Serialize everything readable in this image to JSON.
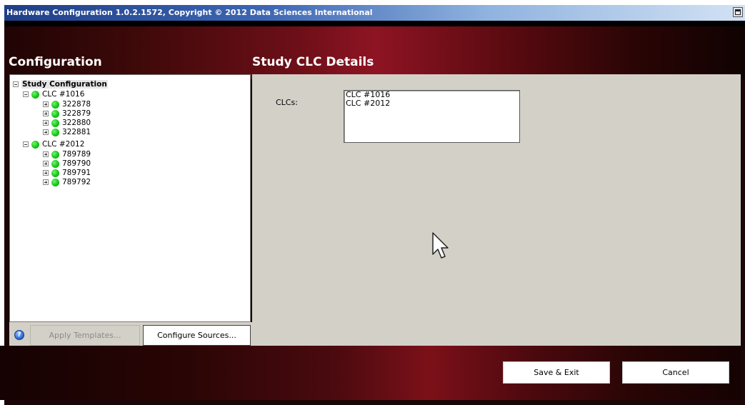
{
  "window": {
    "title": "Hardware Configuration 1.0.2.1572, Copyright © 2012 Data Sciences International"
  },
  "left": {
    "heading": "Configuration",
    "tree": {
      "root": "Study Configuration",
      "groups": [
        {
          "label": "CLC #1016",
          "children": [
            "322878",
            "322879",
            "322880",
            "322881"
          ]
        },
        {
          "label": "CLC #2012",
          "children": [
            "789789",
            "789790",
            "789791",
            "789792"
          ]
        }
      ]
    },
    "buttons": {
      "apply_templates": "Apply Templates...",
      "configure_sources": "Configure Sources..."
    }
  },
  "right": {
    "heading": "Study CLC Details",
    "clcs_label": "CLCs:",
    "clcs": [
      "CLC #1016",
      "CLC #2012"
    ]
  },
  "footer": {
    "save_exit": "Save & Exit",
    "cancel": "Cancel"
  },
  "colors": {
    "status_green": "#17c717",
    "accent_red": "#8e1423",
    "panel_gray": "#d3d0c8"
  },
  "icons": {
    "status": "green-circle",
    "help": "help-icon",
    "tree_expand": "plus-box",
    "tree_collapse": "minus-box"
  }
}
